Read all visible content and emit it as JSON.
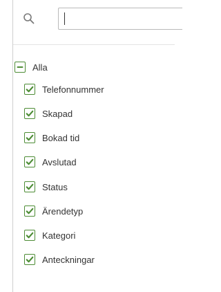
{
  "search": {
    "value": "",
    "placeholder": "",
    "icon": "search-icon"
  },
  "filter": {
    "all_label": "Alla",
    "all_state": "indeterminate",
    "accent_color": "#4d8c35",
    "items": [
      {
        "label": "Telefonnummer",
        "checked": true
      },
      {
        "label": "Skapad",
        "checked": true
      },
      {
        "label": "Bokad tid",
        "checked": true
      },
      {
        "label": "Avslutad",
        "checked": true
      },
      {
        "label": "Status",
        "checked": true
      },
      {
        "label": "Ärendetyp",
        "checked": true
      },
      {
        "label": "Kategori",
        "checked": true
      },
      {
        "label": "Anteckningar",
        "checked": true
      }
    ]
  }
}
